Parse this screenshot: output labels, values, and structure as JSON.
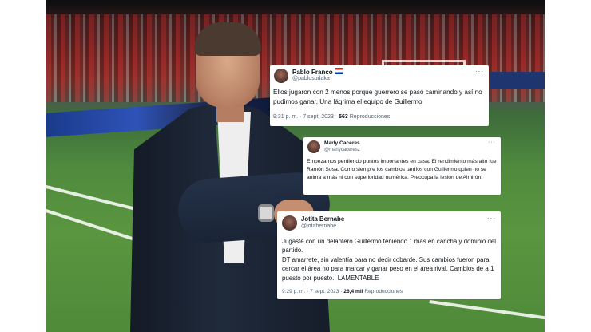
{
  "tweets": [
    {
      "name": "Pablo Franco",
      "handle": "@pablosudaka",
      "more": "···",
      "text": "Ellos jugaron con 2 menos porque guerrero se pasó caminando y así no pudimos ganar. Una lágrima el equipo de Guillermo",
      "time": "9:31 p. m. · 7 sept. 2023 · ",
      "views_count": "563",
      "views_label": " Reproducciones"
    },
    {
      "name": "Marly Caceres",
      "handle": "@marlycaceresz",
      "more": "···",
      "text": "Empezamos perdiendo puntos importantes en casa. El rendimiento más alto fue Ramón Sosa. Como siempre los cambios tardíos con Guillermo quien no se anima a más ni con superioridad numérica. Preocupa la lesión de Almirón."
    },
    {
      "name": "Jotita Bernabe",
      "handle": "@jotabernabe",
      "more": "···",
      "text": "Jugaste con un delantero Guillermo teniendo 1 más en cancha y dominio del partido.\nDT amarrete, sin valentía para no decir cobarde. Sus cambios fueron para cercar el área no para marcar y ganar peso en el área rival. Cambios de a 1 puesto por puesto.. LAMENTABLE",
      "time": "9:29 p. m. · 7 sept. 2023 · ",
      "views_count": "26,4 mil",
      "views_label": " Reproducciones"
    }
  ]
}
